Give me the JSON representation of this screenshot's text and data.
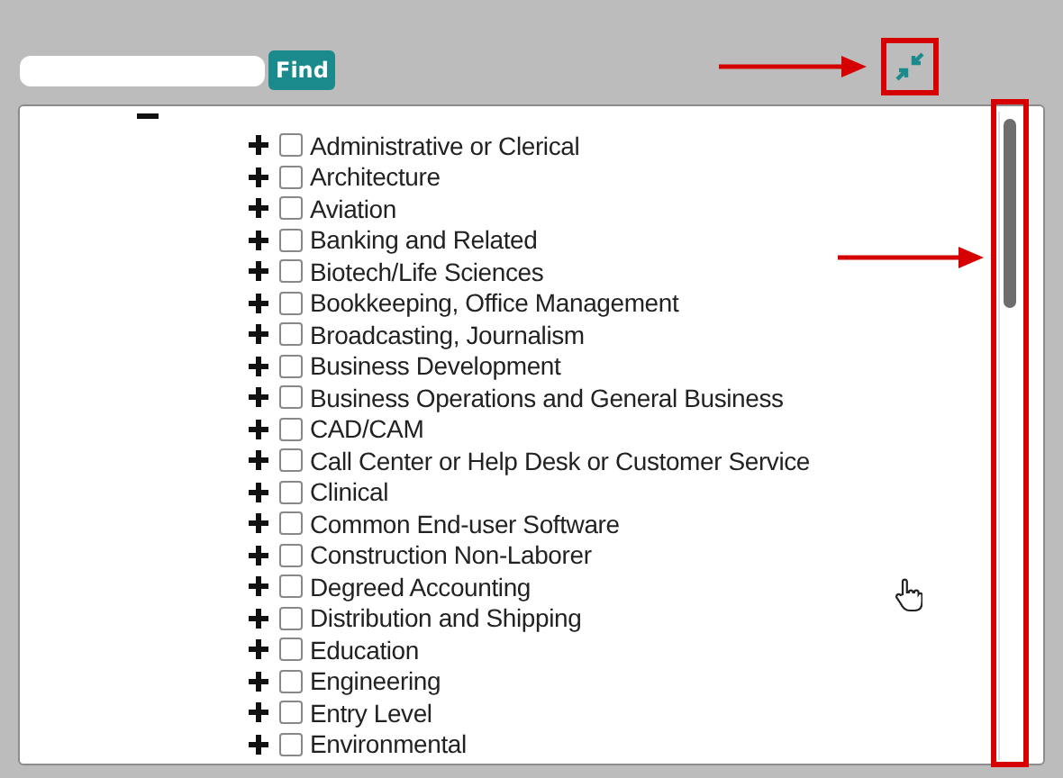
{
  "search": {
    "button": "Find"
  },
  "tree": {
    "expanded": true,
    "children": [
      {
        "label": "Administrative or Clerical",
        "expanded": false,
        "checked": false
      },
      {
        "label": "Architecture",
        "expanded": false,
        "checked": false
      },
      {
        "label": "Aviation",
        "expanded": false,
        "checked": false
      },
      {
        "label": "Banking and Related",
        "expanded": false,
        "checked": false
      },
      {
        "label": "Biotech/Life Sciences",
        "expanded": false,
        "checked": false
      },
      {
        "label": "Bookkeeping, Office Management",
        "expanded": false,
        "checked": false
      },
      {
        "label": "Broadcasting, Journalism",
        "expanded": false,
        "checked": false
      },
      {
        "label": "Business Development",
        "expanded": false,
        "checked": false
      },
      {
        "label": "Business Operations and General Business",
        "expanded": false,
        "checked": false
      },
      {
        "label": "CAD/CAM",
        "expanded": false,
        "checked": false
      },
      {
        "label": "Call Center or Help Desk or Customer Service",
        "expanded": false,
        "checked": false
      },
      {
        "label": "Clinical",
        "expanded": false,
        "checked": false
      },
      {
        "label": "Common End-user Software",
        "expanded": false,
        "checked": false
      },
      {
        "label": "Construction Non-Laborer",
        "expanded": false,
        "checked": false
      },
      {
        "label": "Degreed Accounting",
        "expanded": false,
        "checked": false
      },
      {
        "label": "Distribution and Shipping",
        "expanded": false,
        "checked": false
      },
      {
        "label": "Education",
        "expanded": false,
        "checked": false
      },
      {
        "label": "Engineering",
        "expanded": false,
        "checked": false
      },
      {
        "label": "Entry Level",
        "expanded": false,
        "checked": false
      },
      {
        "label": "Environmental",
        "expanded": false,
        "checked": false
      }
    ]
  }
}
